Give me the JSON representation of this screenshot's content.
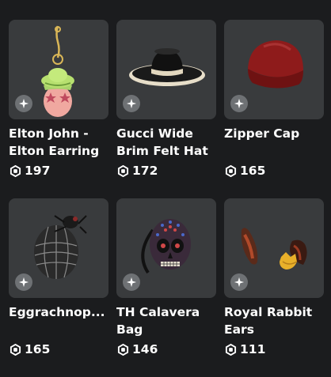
{
  "items": [
    {
      "name": "Elton John - Elton Earring",
      "price": "197",
      "badge_icon": "sparkle-icon",
      "currency_icon": "robux-icon"
    },
    {
      "name": "Gucci Wide Brim Felt Hat",
      "price": "172",
      "badge_icon": "sparkle-icon",
      "currency_icon": "robux-icon"
    },
    {
      "name": "Zipper Cap",
      "price": "165",
      "badge_icon": "sparkle-icon",
      "currency_icon": "robux-icon"
    },
    {
      "name": "Eggrachnop...",
      "price": "165",
      "badge_icon": "sparkle-icon",
      "currency_icon": "robux-icon"
    },
    {
      "name": "TH Calavera Bag",
      "price": "146",
      "badge_icon": "sparkle-icon",
      "currency_icon": "robux-icon"
    },
    {
      "name": "Royal Rabbit Ears",
      "price": "111",
      "badge_icon": "sparkle-icon",
      "currency_icon": "robux-icon"
    }
  ],
  "colors": {
    "background": "#1b1c1e",
    "card": "#393b3d",
    "badge": "#6e7174",
    "text": "#ffffff"
  }
}
